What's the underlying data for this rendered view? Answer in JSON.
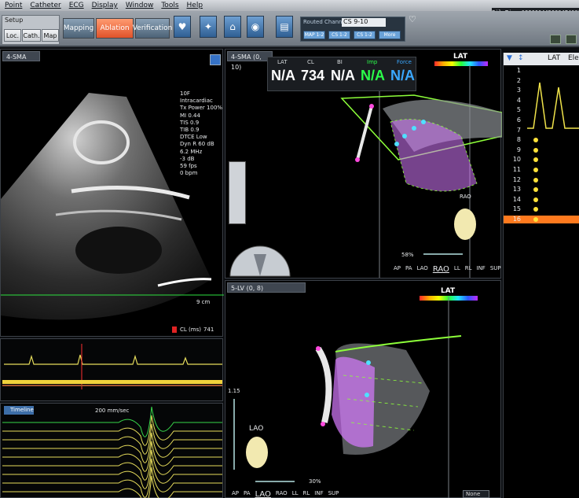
{
  "menu": [
    "Point",
    "Catheter",
    "ECG",
    "Display",
    "Window",
    "Tools",
    "Help"
  ],
  "fileinfo": "FileTime:13366044566047400​1,Time:2024",
  "toolbar": {
    "setup_label": "Setup",
    "setup_buttons": [
      "Loc.",
      "Cath.",
      "Map"
    ],
    "modes": [
      {
        "label": "Mapping",
        "active": false
      },
      {
        "label": "Ablation",
        "active": true
      },
      {
        "label": "Verification",
        "active": false
      }
    ],
    "routed_channel_label": "Routed Channel:",
    "routed_channel_value": "CS 9-10",
    "routed_sub": [
      "MAP 1-2",
      "CS 1-2",
      "CS 1-2",
      "More"
    ]
  },
  "ultrasound": {
    "title": "4-SMA",
    "params": [
      "10F",
      "Intracardiac",
      "Tx Power 100%",
      "MI 0.44",
      "TIS 0.9",
      "TIB 0.9",
      "DTCE Low",
      "Dyn R 60 dB",
      "6.2 MHz",
      "-3 dB",
      "59 fps",
      "0 bpm"
    ],
    "depth": "9 cm",
    "cl_label": "CL (ms)",
    "cl_value": "741"
  },
  "ecg": {
    "speed": "200 mm/sec",
    "timeline_label": "Timeline"
  },
  "map1": {
    "title": "4-SMA (0, 10)",
    "lat_label": "LAT",
    "orientation": "RAO",
    "zoom": "58%",
    "views": [
      "AP",
      "PA",
      "LAO",
      "RAO",
      "LL",
      "RL",
      "INF",
      "SUP"
    ],
    "selected_view": "RAO"
  },
  "readout": {
    "headers": [
      {
        "label": "LAT",
        "color": "#d6dadd"
      },
      {
        "label": "CL",
        "color": "#d6dadd"
      },
      {
        "label": "BI",
        "color": "#d6dadd"
      },
      {
        "label": "Imp",
        "color": "#2bff4a"
      },
      {
        "label": "Force",
        "color": "#3aa8ff"
      }
    ],
    "values": [
      {
        "text": "N/A",
        "color": "#ffffff"
      },
      {
        "text": "734",
        "color": "#ffffff"
      },
      {
        "text": "N/A",
        "color": "#ffffff"
      },
      {
        "text": "N/A",
        "color": "#2bff4a"
      },
      {
        "text": "N/A",
        "color": "#3aa8ff"
      }
    ]
  },
  "map2": {
    "title": "5-LV (0, 8)",
    "lat_label": "LAT",
    "orientation": "LAO",
    "scale_value": "1.15",
    "zoom": "30%",
    "views": [
      "AP",
      "PA",
      "LAO",
      "RAO",
      "LL",
      "RL",
      "INF",
      "SUP"
    ],
    "selected_view": "LAO",
    "dropdown": "None"
  },
  "right_list": {
    "header_lat": "LAT",
    "header_extra": "Ele",
    "rows": [
      "1",
      "2",
      "3",
      "4",
      "5",
      "6",
      "7",
      "8",
      "9",
      "10",
      "11",
      "12",
      "13",
      "14",
      "15",
      "16"
    ],
    "selected_row": "16"
  },
  "colors": {
    "ablation_active": "#e0522a",
    "mesh_green": "#8dff3a",
    "tissue_magenta": "#d77aff",
    "ecg_yellow": "#f0e34a",
    "selected_row": "#ff7a1e"
  }
}
